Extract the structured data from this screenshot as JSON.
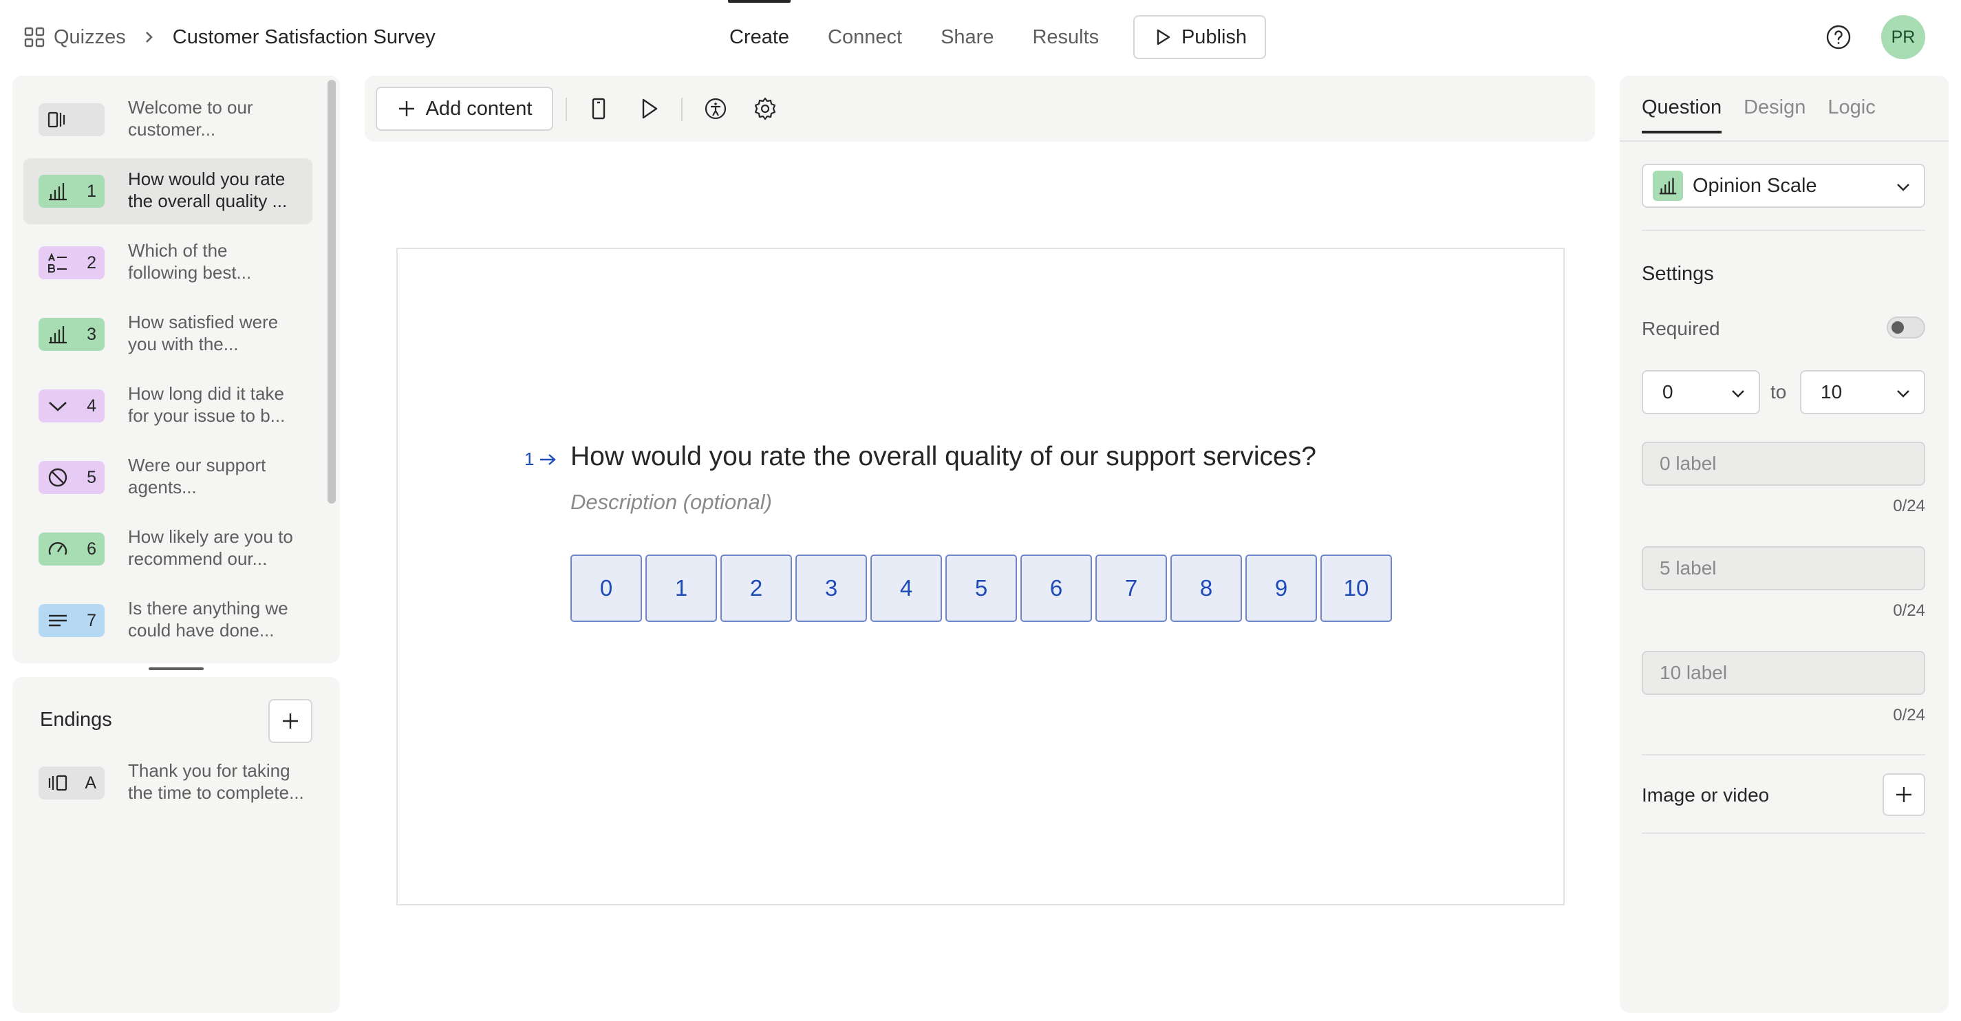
{
  "breadcrumb": {
    "root": "Quizzes",
    "title": "Customer Satisfaction Survey"
  },
  "nav": {
    "tabs": [
      "Create",
      "Connect",
      "Share",
      "Results"
    ],
    "active": "Create",
    "publish_label": "Publish"
  },
  "user": {
    "initials": "PR",
    "avatar_color": "#a8dcb3"
  },
  "sidebar": {
    "welcome": {
      "text": "Welcome to our\ncustomer...",
      "icon": "welcome-screen-icon"
    },
    "questions": [
      {
        "num": "1",
        "text": "How would you rate\nthe overall quality ...",
        "icon": "opinion-scale-icon",
        "color": "#a8dcb3"
      },
      {
        "num": "2",
        "text": "Which of the\nfollowing best...",
        "icon": "multiple-choice-icon",
        "color": "#e6ccf5"
      },
      {
        "num": "3",
        "text": "How satisfied were\nyou with the...",
        "icon": "opinion-scale-icon",
        "color": "#a8dcb3"
      },
      {
        "num": "4",
        "text": "How long did it take\nfor your issue to b...",
        "icon": "dropdown-icon",
        "color": "#e6ccf5"
      },
      {
        "num": "5",
        "text": "Were our support\nagents...",
        "icon": "yes-no-icon",
        "color": "#e6ccf5"
      },
      {
        "num": "6",
        "text": "How likely are you to\nrecommend our...",
        "icon": "nps-gauge-icon",
        "color": "#a8dcb3"
      },
      {
        "num": "7",
        "text": "Is there anything we\ncould have done...",
        "icon": "long-text-icon",
        "color": "#b5d8f5"
      }
    ],
    "endings_title": "Endings",
    "ending": {
      "letter": "A",
      "text": "Thank you for taking\nthe time to complete...",
      "icon": "end-screen-icon"
    }
  },
  "toolbar": {
    "add_content_label": "Add content"
  },
  "question": {
    "number": "1",
    "title": "How would you rate the overall quality of our support services?",
    "description_placeholder": "Description (optional)",
    "scale": [
      "0",
      "1",
      "2",
      "3",
      "4",
      "5",
      "6",
      "7",
      "8",
      "9",
      "10"
    ],
    "accent": "#1e4bb8"
  },
  "panel": {
    "tabs": [
      "Question",
      "Design",
      "Logic"
    ],
    "active_tab": "Question",
    "type_label": "Opinion Scale",
    "settings_title": "Settings",
    "required_label": "Required",
    "required_on": false,
    "range_from": "0",
    "range_to_word": "to",
    "range_to": "10",
    "labels": [
      {
        "placeholder": "0 label",
        "counter": "0/24"
      },
      {
        "placeholder": "5 label",
        "counter": "0/24"
      },
      {
        "placeholder": "10 label",
        "counter": "0/24"
      }
    ],
    "media_label": "Image or video"
  }
}
